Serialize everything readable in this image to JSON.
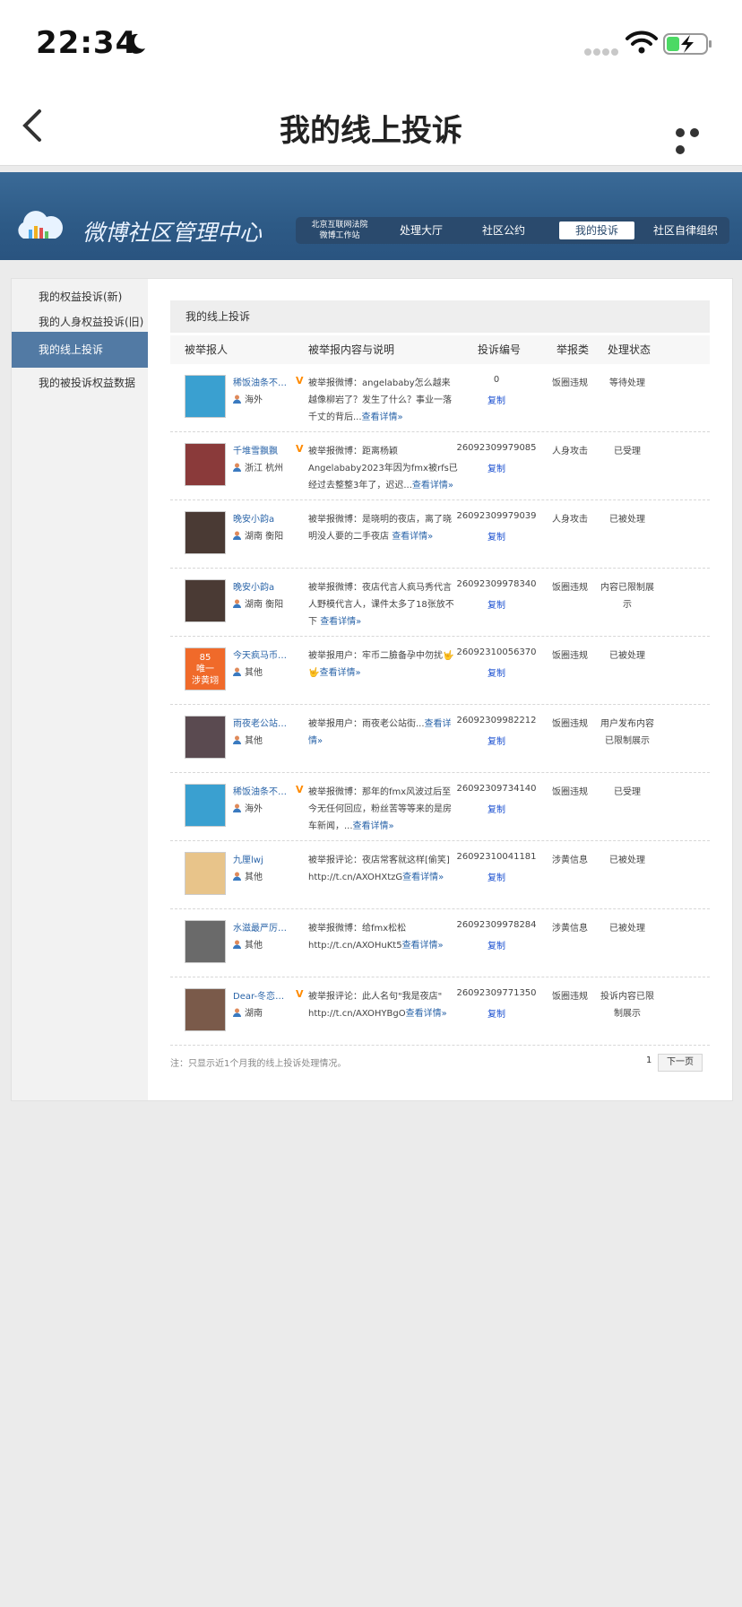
{
  "status_bar": {
    "time": "22:34"
  },
  "nav": {
    "title": "我的线上投诉"
  },
  "banner": {
    "title": "微博社区管理中心",
    "tabs": [
      "北京互联网法院\n微博工作站",
      "处理大厅",
      "社区公约",
      "我的投诉",
      "社区自律组织"
    ],
    "active_tab": "我的投诉"
  },
  "sidebar": {
    "items": [
      "我的权益投诉(新)",
      "我的人身权益投诉(旧)",
      "我的线上投诉",
      "我的被投诉权益数据"
    ],
    "active": "我的线上投诉"
  },
  "content": {
    "title": "我的线上投诉",
    "columns": [
      "被举报人",
      "被举报内容与说明",
      "投诉编号",
      "举报类",
      "处理状态"
    ],
    "copy_label": "复制",
    "rows": [
      {
        "name": "稀饭油条不熬...",
        "verified": "V",
        "location": "海外",
        "desc": "被举报微博：angelababy怎么越来越像柳岩了？发生了什么？事业一落千丈的背后...",
        "more": "查看详情»",
        "number": "0",
        "category": "饭圈违规",
        "status": "等待处理",
        "avatar_color": "#3aa0d0"
      },
      {
        "name": "千堆雪飘飘",
        "verified": "V",
        "location": "浙江 杭州",
        "desc": "被举报微博：距离杨颖Angelababy2023年因为fmx被rfs已经过去整整3年了，迟迟...",
        "more": "查看详情»",
        "number": "26092309979085",
        "category": "人身攻击",
        "status": "已受理",
        "avatar_color": "#8a3a3a"
      },
      {
        "name": "晚安小韵a",
        "verified": "",
        "location": "湖南 衡阳",
        "desc": "被举报微博：是晓明的夜店，离了晓明没人要的二手夜店 ",
        "more": "查看详情»",
        "number": "26092309979039",
        "category": "人身攻击",
        "status": "已被处理",
        "avatar_color": "#4a3a34"
      },
      {
        "name": "晚安小韵a",
        "verified": "",
        "location": "湖南 衡阳",
        "desc": "被举报微博：夜店代言人疯马秀代言人野模代言人，课件太多了18张放不下 ",
        "more": "查看详情»",
        "number": "26092309978340",
        "category": "饭圈违规",
        "status": "内容已限制展示",
        "avatar_color": "#4a3a34"
      },
      {
        "name": "今天疯马币找...",
        "verified": "",
        "location": "其他",
        "desc": "被举报用户：牢币二臉备孕中勿扰🤟🤟",
        "more": "查看详情»",
        "number": "26092310056370",
        "category": "饭圈违规",
        "status": "已被处理",
        "avatar_color": "#f06a2a",
        "avatar_text": "85\n唯一\n涉黄翊"
      },
      {
        "name": "雨夜老公站街...",
        "verified": "",
        "location": "其他",
        "desc": "被举报用户：雨夜老公站街...",
        "more": "查看详情»",
        "number": "26092309982212",
        "category": "饭圈违规",
        "status": "用户发布内容已限制展示",
        "avatar_color": "#5a4a50"
      },
      {
        "name": "稀饭油条不熬...",
        "verified": "V",
        "location": "海外",
        "desc": "被举报微博：那年的fmx风波过后至今无任何回应，粉丝苦等等来的是房车新闻，...",
        "more": "查看详情»",
        "number": "26092309734140",
        "category": "饭圈违规",
        "status": "已受理",
        "avatar_color": "#3aa0d0"
      },
      {
        "name": "九厘lwj",
        "verified": "",
        "location": "其他",
        "desc": "被举报评论：夜店常客就这样[偷笑] http://t.cn/AXOHXtzG",
        "more": "查看详情»",
        "number": "26092310041181",
        "category": "涉黄信息",
        "status": "已被处理",
        "avatar_color": "#e8c48a"
      },
      {
        "name": "水滋最严厉的...",
        "verified": "",
        "location": "其他",
        "desc": "被举报微博：给fmx松松 http://t.cn/AXOHuKt5",
        "more": "查看详情»",
        "number": "26092309978284",
        "category": "涉黄信息",
        "status": "已被处理",
        "avatar_color": "#6a6a6a"
      },
      {
        "name": "Dear-冬恋慕...",
        "verified": "V",
        "location": "湖南",
        "desc": "被举报评论：此人名句\"我是夜店\" http://t.cn/AXOHYBgO",
        "more": "查看详情»",
        "number": "26092309771350",
        "category": "饭圈违规",
        "status": "投诉内容已限制展示",
        "avatar_color": "#7a5a4a"
      }
    ],
    "note": "注：只显示近1个月我的线上投诉处理情况。",
    "page": "1",
    "next_label": "下一页"
  }
}
